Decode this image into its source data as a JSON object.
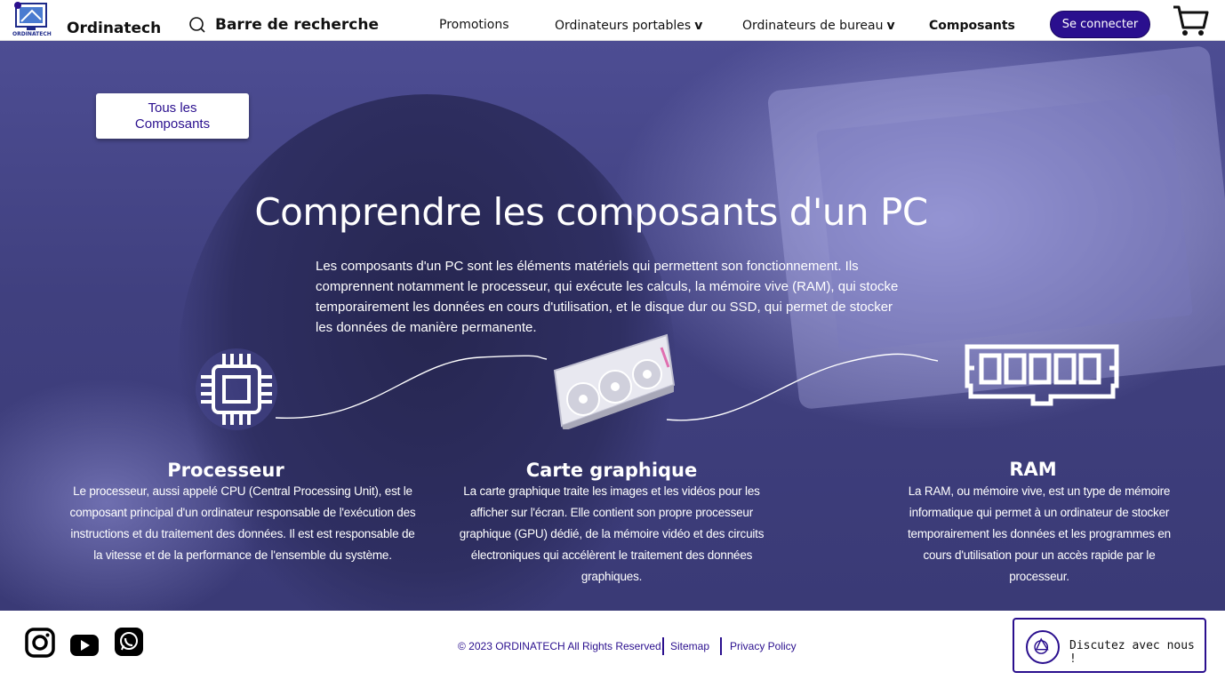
{
  "header": {
    "logo_text": "ORDINATECH",
    "brand": "Ordinatech",
    "search_label": "Barre de recherche",
    "nav": [
      {
        "label": "Promotions",
        "chevron": ""
      },
      {
        "label": "Ordinateurs portables",
        "chevron": "v"
      },
      {
        "label": "Ordinateurs de bureau",
        "chevron": "v"
      },
      {
        "label": "Composants",
        "chevron": ""
      }
    ],
    "login": "Se connecter"
  },
  "hero": {
    "all_components_button": "Tous les Composants",
    "title": "Comprendre les composants d'un PC",
    "intro": "Les composants d'un PC sont les éléments matériels qui permettent son fonctionnement. Ils comprennent notamment le processeur, qui exécute les calculs, la mémoire vive (RAM), qui stocke temporairement les données en cours d'utilisation, et le disque dur ou SSD, qui permet de stocker les données de manière permanente."
  },
  "components": [
    {
      "icon": "cpu-icon",
      "name": "Processeur",
      "description": "Le processeur, aussi appelé CPU (Central Processing Unit), est le composant principal d'un ordinateur responsable de l'exécution des instructions et du traitement des données. Il est est responsable de la vitesse et de la performance de l'ensemble du système."
    },
    {
      "icon": "graphics-card-icon",
      "name": "Carte graphique",
      "description": "La carte graphique traite les images et les vidéos pour les afficher sur l'écran. Elle contient son propre processeur graphique (GPU) dédié, de la mémoire vidéo et des circuits électroniques qui accélèrent le traitement des données graphiques."
    },
    {
      "icon": "ram-icon",
      "name": "RAM",
      "description": "La RAM, ou mémoire vive, est un type de mémoire informatique qui permet à un ordinateur de stocker temporairement les données et les programmes en cours d'utilisation pour un accès rapide par le processeur."
    }
  ],
  "footer": {
    "social": [
      "instagram-icon",
      "youtube-icon",
      "whatsapp-icon"
    ],
    "copyright": "© 2023 ORDINATECH All Rights Reserved.",
    "sitemap": "Sitemap",
    "privacy": "Privacy Policy",
    "chat": "Discutez avec nous !"
  },
  "colors": {
    "accent": "#2a0f8e",
    "hero_overlay": "#46468a"
  }
}
